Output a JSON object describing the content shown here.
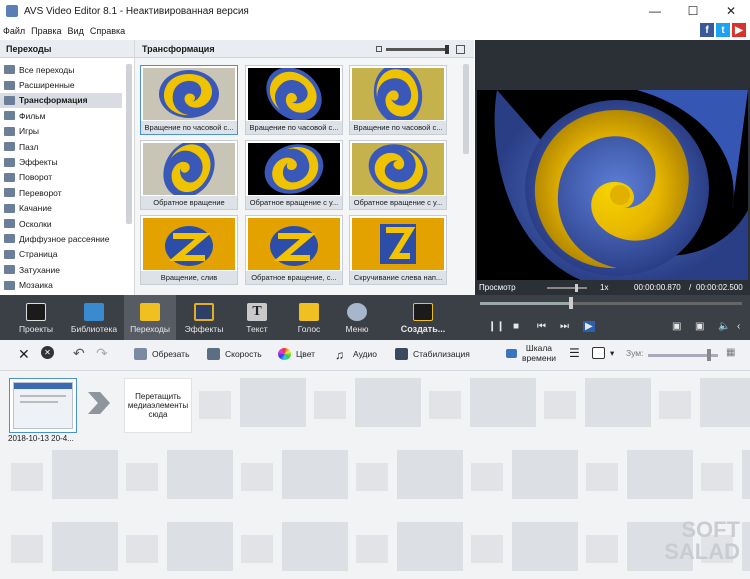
{
  "window": {
    "title": "AVS Video Editor 8.1 - Неактивированная версия"
  },
  "menu": {
    "items": [
      "Файл",
      "Правка",
      "Вид",
      "Справка"
    ]
  },
  "left_panel": {
    "header": "Переходы",
    "categories": [
      "Все переходы",
      "Расширенные",
      "Трансформация",
      "Фильм",
      "Игры",
      "Пазл",
      "Эффекты",
      "Поворот",
      "Переворот",
      "Качание",
      "Осколки",
      "Диффузное рассеяние",
      "Страница",
      "Затухание",
      "Мозаика"
    ],
    "selected": "Трансформация"
  },
  "transitions": {
    "header": "Трансформация",
    "items": [
      "Вращение по часовой с...",
      "Вращение по часовой с...",
      "Вращение по часовой с...",
      "Обратное вращение",
      "Обратное вращение с у...",
      "Обратное вращение с у...",
      "Вращение, слив",
      "Обратное вращение, с...",
      "Скручивание слева нап..."
    ]
  },
  "preview": {
    "label": "Просмотр",
    "speed": "1x",
    "time_current": "00:00:00.870",
    "time_total": "00:00:02.500",
    "progress": 0.348
  },
  "toolbar": {
    "items": [
      "Проекты",
      "Библиотека",
      "Переходы",
      "Эффекты",
      "Текст",
      "Голос",
      "Меню",
      "Создать..."
    ],
    "selected": "Переходы"
  },
  "edit_toolbar": {
    "trim": "Обрезать",
    "speed": "Скорость",
    "color": "Цвет",
    "audio": "Аудио",
    "stabilize": "Стабилизация",
    "timeline_scale": "Шкала\nвремени",
    "zoom": "Зум:"
  },
  "timeline": {
    "clip_label": "2018-10-13 20-4...",
    "drop_hint": "Перетащить медиаэлементы сюда"
  },
  "watermark": {
    "text": "SOFT\nSALAD"
  }
}
